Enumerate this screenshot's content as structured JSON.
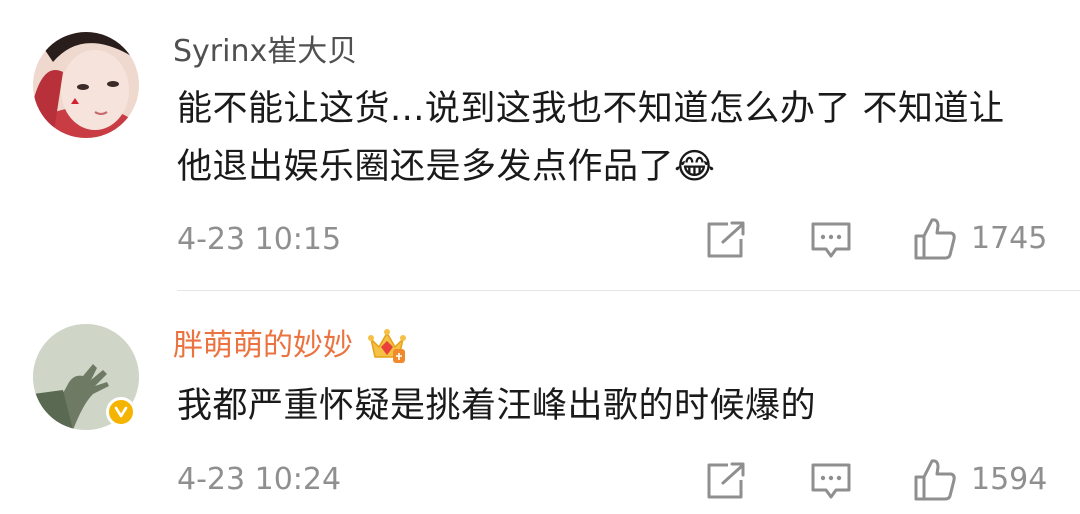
{
  "comments": [
    {
      "username": "Syrinx崔大贝",
      "text": "能不能让这货...说到这我也不知道怎么办了 不知道让他退出娱乐圈还是多发点作品了",
      "emoji": "😂",
      "time": "4-23 10:15",
      "likes": "1745",
      "username_color": "#505050"
    },
    {
      "username": "胖萌萌的妙妙",
      "text": "我都严重怀疑是挑着汪峰出歌的时候爆的",
      "time": "4-23 10:24",
      "likes": "1594",
      "username_color": "#eb7340",
      "badge_icon": "crown-vip-icon",
      "verified": true
    }
  ],
  "icons": {
    "share": "share-icon",
    "reply": "comment-icon",
    "like": "thumbs-up-icon"
  }
}
